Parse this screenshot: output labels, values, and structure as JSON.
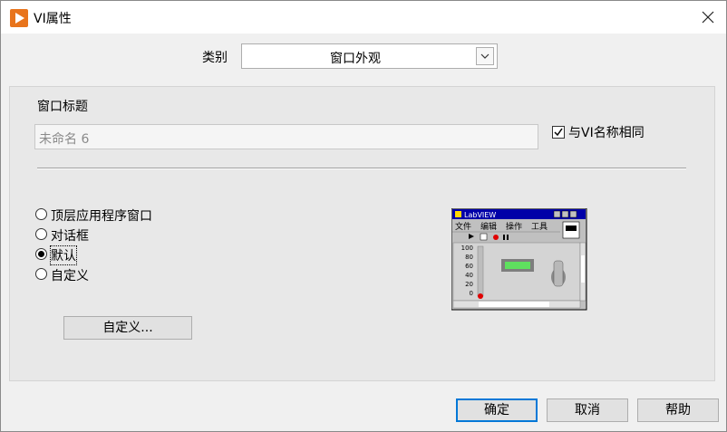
{
  "window": {
    "title": "VI属性",
    "close_glyph": "✕"
  },
  "category": {
    "label": "类别",
    "value": "窗口外观"
  },
  "window_title": {
    "label": "窗口标题",
    "value": "未命名 6"
  },
  "same_as_vi": {
    "label": "与VI名称相同",
    "checked": true
  },
  "radios": [
    {
      "label": "顶层应用程序窗口",
      "selected": false
    },
    {
      "label": "对话框",
      "selected": false
    },
    {
      "label": "默认",
      "selected": true
    },
    {
      "label": "自定义",
      "selected": false
    }
  ],
  "customize_button": "自定义...",
  "preview": {
    "title": "LabVIEW",
    "menu": [
      "文件",
      "编辑",
      "操作",
      "工具"
    ],
    "scale": [
      "100",
      "80",
      "60",
      "40",
      "20",
      "0"
    ]
  },
  "footer": {
    "ok": "确定",
    "cancel": "取消",
    "help": "帮助"
  }
}
